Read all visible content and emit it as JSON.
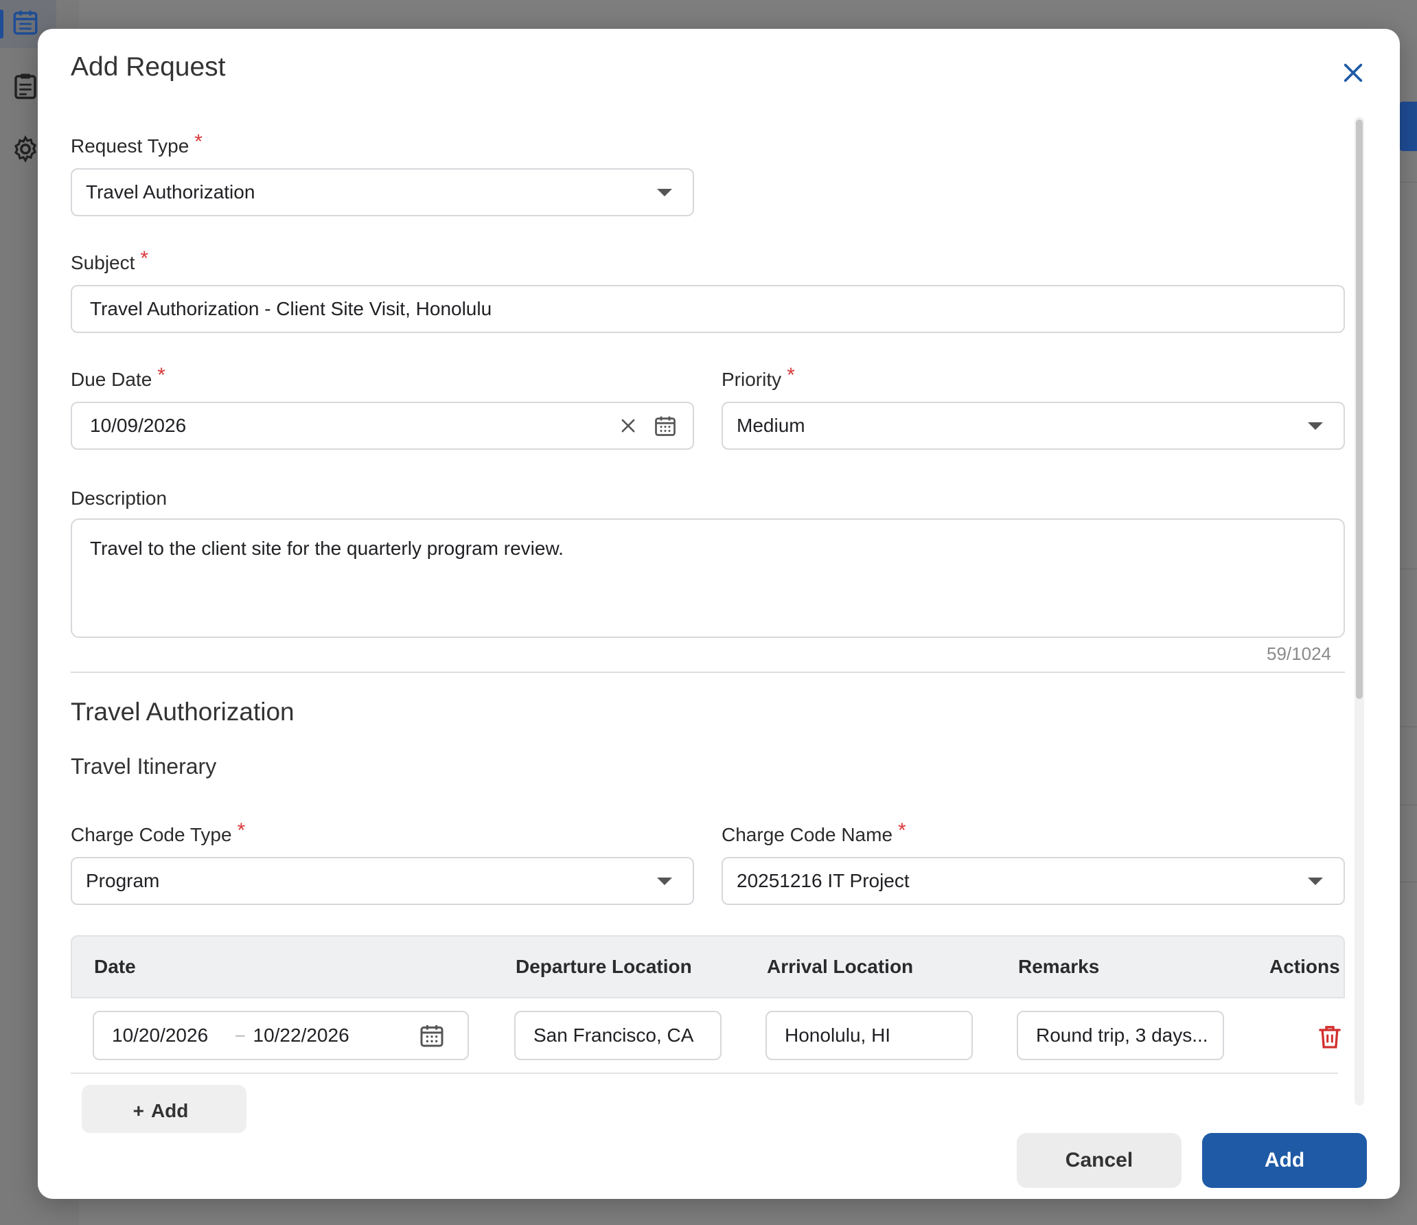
{
  "modal": {
    "title": "Add Request",
    "close_icon": "close-icon"
  },
  "form": {
    "request_type": {
      "label": "Request Type",
      "required_mark": "*",
      "value": "Travel Authorization"
    },
    "subject": {
      "label": "Subject",
      "required_mark": "*",
      "value": "Travel Authorization - Client Site Visit, Honolulu"
    },
    "due_date": {
      "label": "Due Date",
      "required_mark": "*",
      "value": "10/09/2026"
    },
    "priority": {
      "label": "Priority",
      "required_mark": "*",
      "value": "Medium"
    },
    "description": {
      "label": "Description",
      "value": "Travel to the client site for the quarterly program review.",
      "counter": "59/1024"
    }
  },
  "travel": {
    "section_title": "Travel Authorization",
    "itinerary_title": "Travel Itinerary",
    "charge_code_type": {
      "label": "Charge Code Type",
      "required_mark": "*",
      "value": "Program"
    },
    "charge_code_name": {
      "label": "Charge Code Name",
      "required_mark": "*",
      "value": "20251216 IT Project"
    },
    "table": {
      "headers": {
        "date": "Date",
        "departure": "Departure Location",
        "arrival": "Arrival Location",
        "remarks": "Remarks",
        "actions": "Actions"
      },
      "rows": [
        {
          "start_date": "10/20/2026",
          "separator": "–",
          "end_date": "10/22/2026",
          "departure": "San Francisco, CA",
          "arrival": "Honolulu, HI",
          "remarks": "Round trip, 3 days..."
        }
      ]
    },
    "add_row_label": "Add",
    "add_row_icon": "+"
  },
  "footer": {
    "cancel_label": "Cancel",
    "add_label": "Add"
  },
  "colors": {
    "primary": "#1f5aa6",
    "required": "#d93a3a",
    "delete": "#d32f2f"
  }
}
